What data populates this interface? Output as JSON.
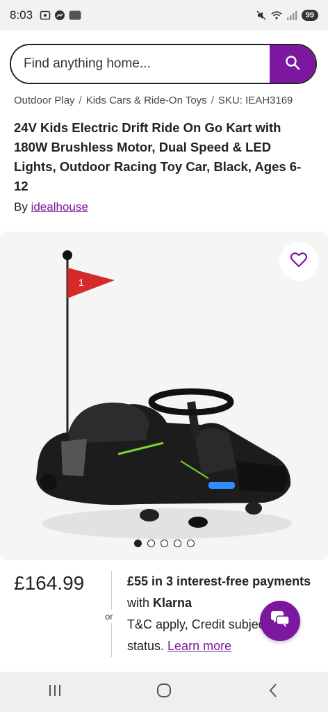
{
  "status_bar": {
    "time": "8:03",
    "small_tag": "ring",
    "battery": "99"
  },
  "search": {
    "placeholder": "Find anything home..."
  },
  "breadcrumb": {
    "items": [
      "Outdoor Play",
      "Kids Cars & Ride-On Toys",
      "SKU: IEAH3169"
    ]
  },
  "product": {
    "title": "24V Kids Electric Drift Ride On Go Kart with 180W Brushless Motor, Dual Speed & LED Lights, Outdoor Racing Toy Car, Black, Ages 6-12",
    "by_label": "By",
    "seller": "idealhouse",
    "flag_number": "1",
    "images_count": 5,
    "active_image": 1
  },
  "pricing": {
    "price": "£164.99",
    "or_label": "or",
    "klarna_bold": "£55 in 3 interest-free payments",
    "klarna_with": " with ",
    "klarna_brand": "Klarna",
    "klarna_terms": "T&C apply, Credit subject to status.",
    "learn_more": "Learn more"
  },
  "colors": {
    "brand": "#7b189f",
    "flag": "#d42a2a"
  }
}
